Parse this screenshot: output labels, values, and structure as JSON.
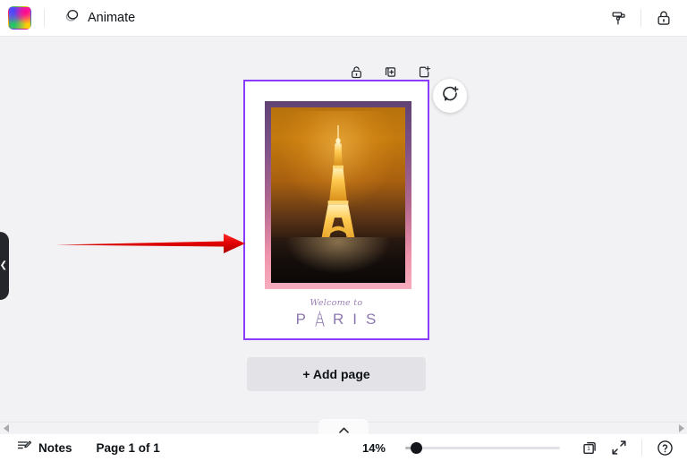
{
  "app": {
    "name": "design-editor",
    "accent_purple": "#8b3dff",
    "canvas_bg": "#f2f2f4"
  },
  "topbar": {
    "logo_name": "app-logo-rainbow",
    "animate_label": "Animate",
    "animate_icon": "animate-circles-icon",
    "right_buttons": [
      {
        "name": "paint-roller-icon",
        "label": ""
      },
      {
        "name": "lock-icon",
        "label": ""
      }
    ]
  },
  "left_panel": {
    "collapse_icon": "chevron-left-icon"
  },
  "page_tools": [
    {
      "name": "unlock-icon",
      "label": ""
    },
    {
      "name": "duplicate-page-icon",
      "label": ""
    },
    {
      "name": "add-page-icon",
      "label": ""
    }
  ],
  "comment": {
    "icon": "comment-plus-icon"
  },
  "page": {
    "selected": true,
    "frame_gradient_top": "#5f4273",
    "frame_gradient_bottom": "#f7adbe",
    "photo_alt": "eiffel-tower-at-night",
    "caption_script": "Welcome to",
    "caption_title_letters": [
      "P",
      "A",
      "R",
      "I",
      "S"
    ],
    "caption_color": "#8d77ae"
  },
  "add_page_button": {
    "label": "+ Add page"
  },
  "annotation": {
    "arrow_color": "#e00000",
    "direction": "right"
  },
  "scrollbar": {
    "left_arrow": "triangle-left-icon",
    "right_arrow": "triangle-right-icon",
    "expand_tab_icon": "chevron-up-icon"
  },
  "bottombar": {
    "notes_icon": "notes-pencil-icon",
    "notes_label": "Notes",
    "page_indicator": "Page 1 of 1",
    "zoom_value": "14%",
    "zoom_slider_percent": 7,
    "pages_icon": "pages-grid-icon",
    "pages_count": "1",
    "fullscreen_icon": "fullscreen-expand-icon",
    "help_icon": "help-question-icon"
  }
}
